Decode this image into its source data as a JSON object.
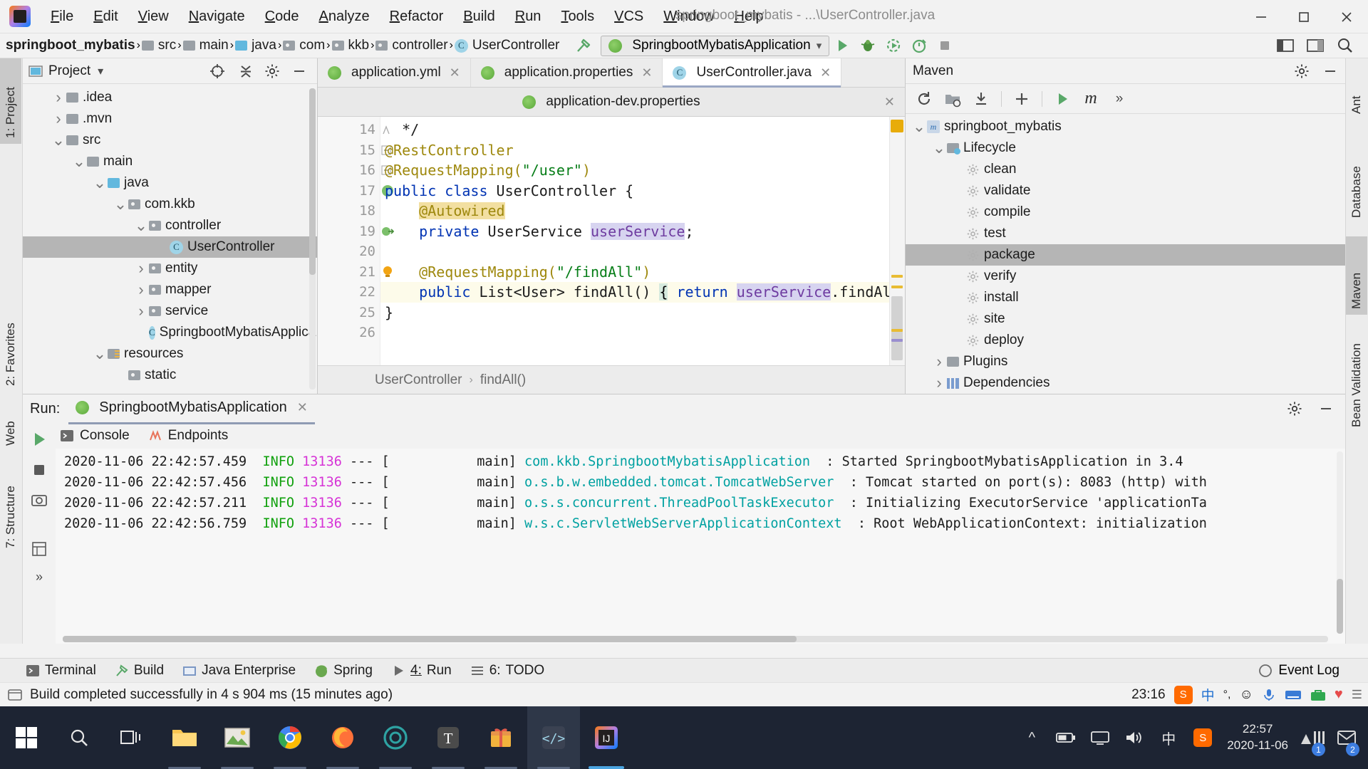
{
  "titlebar": {
    "menu": [
      "File",
      "Edit",
      "View",
      "Navigate",
      "Code",
      "Analyze",
      "Refactor",
      "Build",
      "Run",
      "Tools",
      "VCS",
      "Window",
      "Help"
    ],
    "window_title": "springboot_mybatis - ...\\UserController.java",
    "minimize_label": "—",
    "maximize_label": "▭",
    "close_label": "✕"
  },
  "navbar": {
    "crumbs": [
      {
        "label": "springboot_mybatis",
        "icon": "project-icon"
      },
      {
        "label": "src",
        "icon": "folder-icon"
      },
      {
        "label": "main",
        "icon": "folder-icon"
      },
      {
        "label": "java",
        "icon": "source-folder-icon"
      },
      {
        "label": "com",
        "icon": "package-icon"
      },
      {
        "label": "kkb",
        "icon": "package-icon"
      },
      {
        "label": "controller",
        "icon": "package-icon"
      },
      {
        "label": "UserController",
        "icon": "class-icon"
      }
    ],
    "run_configuration": "SpringbootMybatisApplication",
    "buttons": [
      "run-button",
      "debug-button",
      "run-coverage-button",
      "profiler-button",
      "stop-button",
      "layout-button",
      "search-button"
    ]
  },
  "left_strip": {
    "tabs": [
      "1: Project",
      "2: Favorites",
      "Web",
      "7: Structure"
    ]
  },
  "right_strip": {
    "tabs": [
      "Ant",
      "Database",
      "Maven",
      "Bean Validation"
    ]
  },
  "project_panel": {
    "title": "Project",
    "tree": [
      {
        "label": ".idea",
        "depth": 1,
        "icon": "folder-icon",
        "arrow": "collapsed",
        "selected": false
      },
      {
        "label": ".mvn",
        "depth": 1,
        "icon": "folder-icon",
        "arrow": "collapsed",
        "selected": false
      },
      {
        "label": "src",
        "depth": 1,
        "icon": "folder-icon",
        "arrow": "expanded",
        "selected": false
      },
      {
        "label": "main",
        "depth": 2,
        "icon": "folder-icon",
        "arrow": "expanded",
        "selected": false
      },
      {
        "label": "java",
        "depth": 3,
        "icon": "source-folder-icon",
        "arrow": "expanded",
        "selected": false
      },
      {
        "label": "com.kkb",
        "depth": 4,
        "icon": "package-icon",
        "arrow": "expanded",
        "selected": false
      },
      {
        "label": "controller",
        "depth": 5,
        "icon": "package-icon",
        "arrow": "expanded",
        "selected": false
      },
      {
        "label": "UserController",
        "depth": 6,
        "icon": "class-icon",
        "arrow": "none",
        "selected": true
      },
      {
        "label": "entity",
        "depth": 5,
        "icon": "package-icon",
        "arrow": "collapsed",
        "selected": false
      },
      {
        "label": "mapper",
        "depth": 5,
        "icon": "package-icon",
        "arrow": "collapsed",
        "selected": false
      },
      {
        "label": "service",
        "depth": 5,
        "icon": "package-icon",
        "arrow": "collapsed",
        "selected": false
      },
      {
        "label": "SpringbootMybatisApplica",
        "depth": 5,
        "icon": "spring-class-icon",
        "arrow": "none",
        "selected": false
      },
      {
        "label": "resources",
        "depth": 3,
        "icon": "resources-folder-icon",
        "arrow": "expanded",
        "selected": false
      },
      {
        "label": "static",
        "depth": 4,
        "icon": "package-icon",
        "arrow": "none",
        "selected": false
      }
    ]
  },
  "editor": {
    "tabs": [
      {
        "label": "application.yml",
        "icon": "spring-file-icon",
        "active": false
      },
      {
        "label": "application.properties",
        "icon": "spring-file-icon",
        "active": false
      },
      {
        "label": "UserController.java",
        "icon": "class-icon",
        "active": true
      }
    ],
    "second_row_tab": {
      "label": "application-dev.properties",
      "icon": "spring-file-icon"
    },
    "lines": [
      {
        "num": "14",
        "marker": "fold-end",
        "segments": [
          {
            "t": "  */",
            "c": "plain"
          }
        ]
      },
      {
        "num": "15",
        "marker": "fold-collapse",
        "segments": [
          {
            "t": "@RestController",
            "c": "ann"
          }
        ]
      },
      {
        "num": "16",
        "marker": "fold-collapse",
        "segments": [
          {
            "t": "@RequestMapping(",
            "c": "ann"
          },
          {
            "t": "\"/user\"",
            "c": "str"
          },
          {
            "t": ")",
            "c": "ann"
          }
        ]
      },
      {
        "num": "17",
        "marker": "bean-icon",
        "segments": [
          {
            "t": "public ",
            "c": "kw"
          },
          {
            "t": "class ",
            "c": "kw"
          },
          {
            "t": "UserController {",
            "c": "plain"
          }
        ]
      },
      {
        "num": "18",
        "marker": "",
        "segments": [
          {
            "t": "    ",
            "c": "plain"
          },
          {
            "t": "@Autowired",
            "c": "annhl"
          }
        ]
      },
      {
        "num": "19",
        "marker": "autowire-icon",
        "segments": [
          {
            "t": "    ",
            "c": "plain"
          },
          {
            "t": "private ",
            "c": "kw"
          },
          {
            "t": "UserService ",
            "c": "plain"
          },
          {
            "t": "userService",
            "c": "fieldhl"
          },
          {
            "t": ";",
            "c": "plain"
          }
        ]
      },
      {
        "num": "20",
        "marker": "",
        "segments": []
      },
      {
        "num": "21",
        "marker": "bulb-icon",
        "segments": [
          {
            "t": "    ",
            "c": "plain"
          },
          {
            "t": "@RequestMapping(",
            "c": "ann"
          },
          {
            "t": "\"/findAll\"",
            "c": "str"
          },
          {
            "t": ")",
            "c": "ann"
          }
        ]
      },
      {
        "num": "22",
        "marker": "fold-expand",
        "highlight": true,
        "segments": [
          {
            "t": "    ",
            "c": "plain"
          },
          {
            "t": "public ",
            "c": "kw"
          },
          {
            "t": "List<User> findAll() ",
            "c": "plain"
          },
          {
            "t": "{",
            "c": "brhl"
          },
          {
            "t": " ",
            "c": "plain"
          },
          {
            "t": "return ",
            "c": "kw"
          },
          {
            "t": "userService",
            "c": "fieldhl"
          },
          {
            "t": ".findAll(); ",
            "c": "plain"
          },
          {
            "t": "}",
            "c": "brhl"
          }
        ]
      },
      {
        "num": "25",
        "marker": "",
        "segments": [
          {
            "t": "}",
            "c": "plain"
          }
        ]
      },
      {
        "num": "26",
        "marker": "",
        "segments": []
      }
    ],
    "breadcrumb": [
      "UserController",
      "findAll()"
    ]
  },
  "maven_panel": {
    "title": "Maven",
    "toolbar": [
      "reload-icon",
      "add-module-icon",
      "download-sources-icon",
      "add-icon",
      "run-icon",
      "execute-maven-goal-icon",
      "more-icon"
    ],
    "tree": [
      {
        "label": "springboot_mybatis",
        "depth": 0,
        "icon": "maven-project-icon",
        "arrow": "expanded",
        "selected": false
      },
      {
        "label": "Lifecycle",
        "depth": 1,
        "icon": "lifecycle-icon",
        "arrow": "expanded",
        "selected": false
      },
      {
        "label": "clean",
        "depth": 2,
        "icon": "goal-icon",
        "arrow": "none",
        "selected": false
      },
      {
        "label": "validate",
        "depth": 2,
        "icon": "goal-icon",
        "arrow": "none",
        "selected": false
      },
      {
        "label": "compile",
        "depth": 2,
        "icon": "goal-icon",
        "arrow": "none",
        "selected": false
      },
      {
        "label": "test",
        "depth": 2,
        "icon": "goal-icon",
        "arrow": "none",
        "selected": false
      },
      {
        "label": "package",
        "depth": 2,
        "icon": "goal-icon",
        "arrow": "none",
        "selected": true
      },
      {
        "label": "verify",
        "depth": 2,
        "icon": "goal-icon",
        "arrow": "none",
        "selected": false
      },
      {
        "label": "install",
        "depth": 2,
        "icon": "goal-icon",
        "arrow": "none",
        "selected": false
      },
      {
        "label": "site",
        "depth": 2,
        "icon": "goal-icon",
        "arrow": "none",
        "selected": false
      },
      {
        "label": "deploy",
        "depth": 2,
        "icon": "goal-icon",
        "arrow": "none",
        "selected": false
      },
      {
        "label": "Plugins",
        "depth": 1,
        "icon": "plugins-icon",
        "arrow": "collapsed",
        "selected": false
      },
      {
        "label": "Dependencies",
        "depth": 1,
        "icon": "dependencies-icon",
        "arrow": "collapsed",
        "selected": false
      }
    ]
  },
  "run_panel": {
    "label": "Run:",
    "tab": "SpringbootMybatisApplication",
    "console_tabs": [
      {
        "label": "Console",
        "icon": "console-icon"
      },
      {
        "label": "Endpoints",
        "icon": "endpoints-icon"
      }
    ],
    "log_lines": [
      {
        "ts": "2020-11-06 22:42:56.759",
        "level": "INFO",
        "pid": "13136",
        "thread": "main",
        "logger": "w.s.c.ServletWebServerApplicationContext",
        "msg": ": Root WebApplicationContext: initialization"
      },
      {
        "ts": "2020-11-06 22:42:57.211",
        "level": "INFO",
        "pid": "13136",
        "thread": "main",
        "logger": "o.s.s.concurrent.ThreadPoolTaskExecutor",
        "msg": ": Initializing ExecutorService 'applicationTa"
      },
      {
        "ts": "2020-11-06 22:42:57.456",
        "level": "INFO",
        "pid": "13136",
        "thread": "main",
        "logger": "o.s.b.w.embedded.tomcat.TomcatWebServer",
        "msg": ": Tomcat started on port(s): 8083 (http) with"
      },
      {
        "ts": "2020-11-06 22:42:57.459",
        "level": "INFO",
        "pid": "13136",
        "thread": "main",
        "logger": "com.kkb.SpringbootMybatisApplication",
        "msg": ": Started SpringbootMybatisApplication in 3.4"
      }
    ]
  },
  "bottom_tabs": {
    "tabs": [
      {
        "label": "Terminal",
        "icon": "terminal-icon",
        "num": "",
        "active": false
      },
      {
        "label": "Build",
        "icon": "build-icon",
        "num": "",
        "active": false
      },
      {
        "label": "Java Enterprise",
        "icon": "java-enterprise-icon",
        "num": "",
        "active": false
      },
      {
        "label": "Spring",
        "icon": "spring-icon",
        "num": "",
        "active": false
      },
      {
        "label": "Run",
        "icon": "run-icon",
        "num": "4",
        "active": true
      },
      {
        "label": "TODO",
        "icon": "todo-icon",
        "num": "6",
        "active": false
      }
    ],
    "event_log": "Event Log"
  },
  "statusbar": {
    "message": "Build completed successfully in 4 s 904 ms (15 minutes ago)",
    "time": "23:16",
    "ime": [
      "中",
      "°,",
      "smiley-icon",
      "mic-icon",
      "keyboard-icon",
      "toolbox-icon",
      "heart-icon"
    ]
  },
  "taskbar": {
    "items": [
      {
        "name": "start-button",
        "icon": "windows-icon"
      },
      {
        "name": "search-button",
        "icon": "search-icon"
      },
      {
        "name": "task-view-button",
        "icon": "task-view-icon"
      },
      {
        "name": "file-explorer",
        "icon": "folder-icon"
      },
      {
        "name": "photos-app",
        "icon": "photos-icon"
      },
      {
        "name": "chrome-browser",
        "icon": "chrome-icon"
      },
      {
        "name": "firefox-browser",
        "icon": "firefox-icon"
      },
      {
        "name": "app-circle",
        "icon": "circle-app-icon"
      },
      {
        "name": "typora-app",
        "icon": "typora-icon"
      },
      {
        "name": "gift-app",
        "icon": "gift-icon"
      },
      {
        "name": "vscode-app",
        "icon": "code-icon"
      },
      {
        "name": "intellij-idea",
        "icon": "idea-icon"
      }
    ],
    "tray": [
      "chevron-up-icon",
      "battery-icon",
      "display-icon",
      "volume-icon",
      "ime-icon",
      "sogou-icon"
    ],
    "clock_time": "22:57",
    "clock_date": "2020-11-06",
    "right_icons": [
      {
        "name": "netmeter-icon",
        "badge": "1"
      },
      {
        "name": "notification-icon",
        "badge": "2"
      }
    ]
  },
  "colors": {
    "accent": "#4aa3df",
    "selection": "#b5b5b5",
    "keyword": "#0033b3",
    "string": "#067d17",
    "annotation": "#9e880d",
    "log_info": "#11a10e",
    "log_pid": "#d633d6",
    "log_logger": "#00a1a1",
    "taskbar_bg": "#1d2433"
  }
}
